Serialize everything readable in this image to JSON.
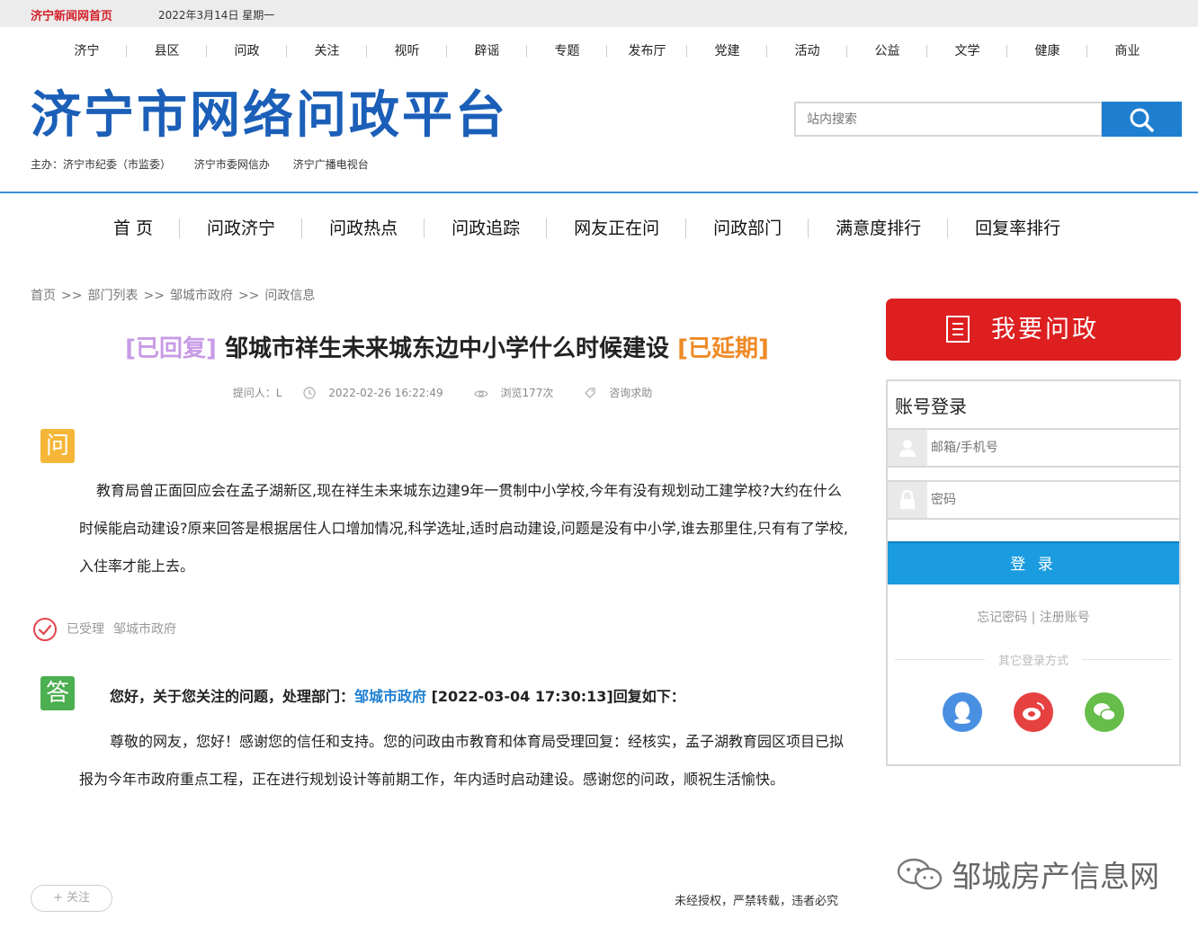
{
  "topbar": {
    "home_link": "济宁新闻网首页",
    "date": "2022年3月14日 星期一"
  },
  "channels": [
    "济宁",
    "县区",
    "问政",
    "关注",
    "视听",
    "辟谣",
    "专题",
    "发布厅",
    "党建",
    "活动",
    "公益",
    "文学",
    "健康",
    "商业"
  ],
  "header": {
    "logo": "济宁市网络问政平台",
    "sponsors": [
      "主办：济宁市纪委（市监委）",
      "济宁市委网信办",
      "济宁广播电视台"
    ],
    "search_placeholder": "站内搜索"
  },
  "mainnav": [
    "首 页",
    "问政济宁",
    "问政热点",
    "问政追踪",
    "网友正在问",
    "问政部门",
    "满意度排行",
    "回复率排行"
  ],
  "breadcrumb": [
    "首页",
    "部门列表",
    "邹城市政府",
    "问政信息"
  ],
  "breadcrumb_sep": ">>",
  "question": {
    "status_replied": "[已回复]",
    "title": "邹城市祥生未来城东边中小学什么时候建设",
    "status_delayed": "[已延期]",
    "asker": "提问人：L",
    "time": "2022-02-26 16:22:49",
    "views": "浏览177次",
    "category": "咨询求助",
    "badge": "问",
    "body": "教育局曾正面回应会在孟子湖新区,现在祥生未来城东边建9年一贯制中小学校,今年有没有规划动工建学校?大约在什么时候能启动建设?原来回答是根据居住人口增加情况,科学选址,适时启动建设,问题是没有中小学,谁去那里住,只有有了学校,入住率才能上去。"
  },
  "status": {
    "label": "已受理",
    "dept": "邹城市政府"
  },
  "reply": {
    "badge": "答",
    "prefix": "您好，关于您关注的问题，处理部门：",
    "dept": "邹城市政府",
    "suffix": " [2022-03-04 17:30:13]回复如下：",
    "body": "尊敬的网友，您好！感谢您的信任和支持。您的问政由市教育和体育局受理回复：经核实，孟子湖教育园区项目已拟报为今年市政府重点工程，正在进行规划设计等前期工作，年内适时启动建设。感谢您的问政，顺祝生活愉快。"
  },
  "follow_label": "+ 关注",
  "copyright": "未经授权，严禁转载，违者必究",
  "sidebar": {
    "ask_label": "我要问政",
    "login_title": "账号登录",
    "username_placeholder": "邮箱/手机号",
    "password_placeholder": "密码",
    "submit_label": "登 录",
    "links": "忘记密码 | 注册账号",
    "other_login": "其它登录方式"
  },
  "watermark": "邹城房产信息网",
  "colors": {
    "brand_blue": "#1b5fb8",
    "accent_red": "#dd1f20",
    "login_blue": "#1b9ce0",
    "replied": "#c79be6",
    "delayed": "#ef8a26"
  }
}
